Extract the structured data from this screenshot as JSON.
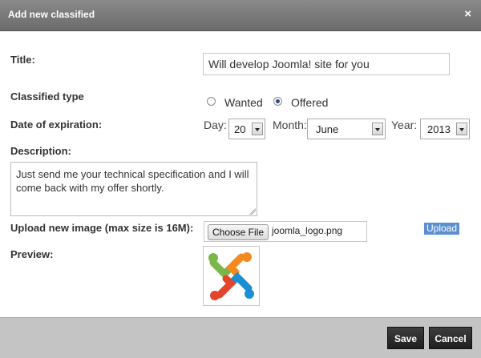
{
  "dialog": {
    "title": "Add new classified",
    "close_glyph": "×"
  },
  "form": {
    "title_label": "Title:",
    "title_value": "Will develop Joomla! site for you",
    "type_label": "Classified type",
    "type_options": [
      {
        "label": "Wanted",
        "checked": false
      },
      {
        "label": "Offered",
        "checked": true
      }
    ],
    "expiration_label": "Date of expiration:",
    "day_label": "Day:",
    "day_value": "20",
    "month_label": "Month:",
    "month_value": "June",
    "year_label": "Year:",
    "year_value": "2013",
    "description_label": "Description:",
    "description_value": "Just send me your technical specification and I will come back with my offer shortly.",
    "upload_label": "Upload new image (max size is 16M):",
    "choose_file_label": "Choose File",
    "file_name": "joomla_logo.png",
    "upload_link_label": "Upload",
    "preview_label": "Preview:",
    "preview_icon": "joomla-logo-icon"
  },
  "footer": {
    "save_label": "Save",
    "cancel_label": "Cancel"
  },
  "colors": {
    "titlebar": "#7a7a7a",
    "footer": "#c4c4c4",
    "button": "#2b2b2b",
    "upload_highlight": "#5b8fd1",
    "logo_green": "#7ab648",
    "logo_orange": "#f48a1f",
    "logo_red": "#e2452c",
    "logo_blue": "#1a8fd5"
  }
}
